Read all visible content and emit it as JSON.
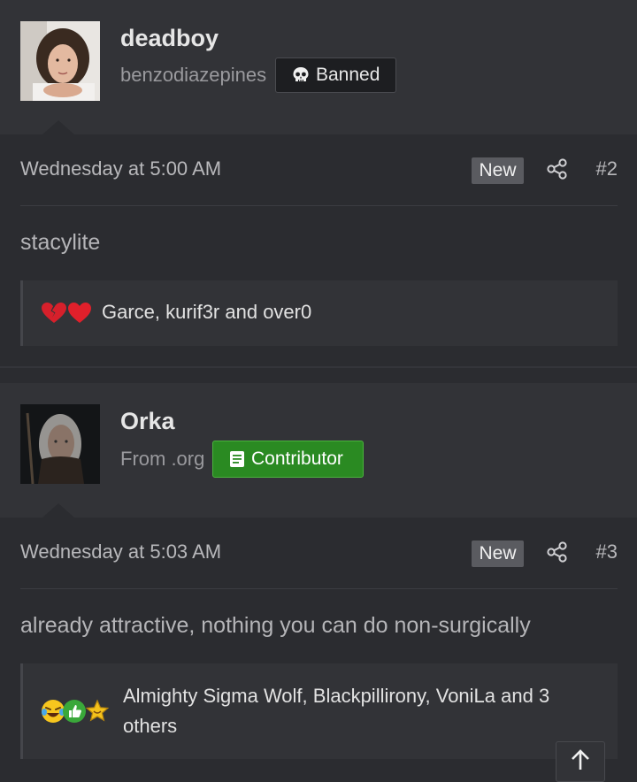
{
  "posts": [
    {
      "username": "deadboy",
      "subtitle": "benzodiazepines",
      "badge": "Banned",
      "date": "Wednesday at 5:00 AM",
      "new_label": "New",
      "number": "#2",
      "body": "stacylite",
      "reactions_text": "Garce, kurif3r and over0"
    },
    {
      "username": "Orka",
      "subtitle": "From .org",
      "badge": "Contributor",
      "date": "Wednesday at 5:03 AM",
      "new_label": "New",
      "number": "#3",
      "body": "already attractive, nothing you can do non-surgically",
      "reactions_text": "Almighty Sigma Wolf, Blackpillirony, VoniLa and 3 others"
    }
  ],
  "colors": {
    "background": "#2b2c30",
    "panel": "#323337",
    "contributor_green": "#2a8a22",
    "banned_dark": "#1d1e21"
  },
  "icons": {
    "banned_badge": "skull-icon",
    "contributor_badge": "book-icon",
    "share": "share-icon",
    "scroll_top": "arrow-up-icon",
    "post1_reactions": [
      "broken-heart-icon",
      "heart-icon"
    ],
    "post2_reactions": [
      "laughing-emoji-icon",
      "thumbs-up-icon",
      "star-icon"
    ]
  }
}
